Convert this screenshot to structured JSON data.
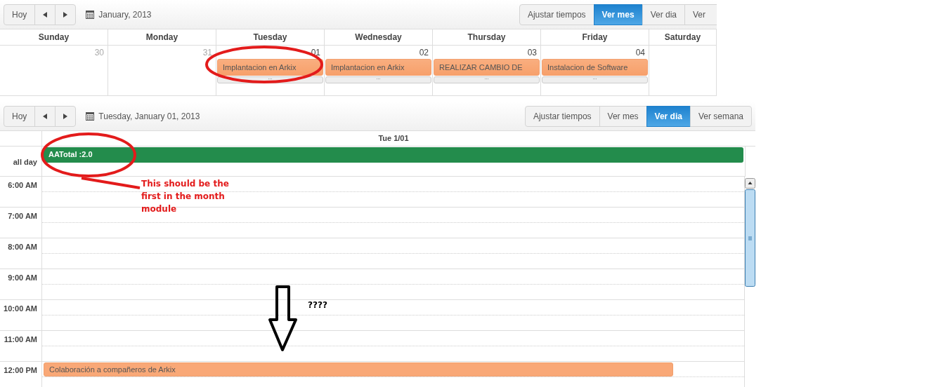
{
  "month_view": {
    "toolbar": {
      "today": "Hoy",
      "title": "January, 2013",
      "views": [
        {
          "label": "Ajustar tiempos",
          "selected": false
        },
        {
          "label": "Ver mes",
          "selected": true
        },
        {
          "label": "Ver dia",
          "selected": false
        },
        {
          "label": "Ver",
          "selected": false
        }
      ]
    },
    "weekdays": [
      "Sunday",
      "Monday",
      "Tuesday",
      "Wednesday",
      "Thursday",
      "Friday",
      "Saturday"
    ],
    "days": [
      {
        "number": "30",
        "other_month": true
      },
      {
        "number": "31",
        "other_month": true
      },
      {
        "number": "01",
        "other_month": false,
        "events": [
          {
            "title": "Implantacion en Arkix",
            "more": "..."
          }
        ]
      },
      {
        "number": "02",
        "other_month": false,
        "events": [
          {
            "title": "Implantacion en Arkix",
            "more": "..."
          }
        ]
      },
      {
        "number": "03",
        "other_month": false,
        "events": [
          {
            "title": "REALIZAR CAMBIO DE",
            "more": "..."
          }
        ]
      },
      {
        "number": "04",
        "other_month": false,
        "events": [
          {
            "title": "Instalacion de Software",
            "more": "..."
          }
        ]
      }
    ]
  },
  "day_view": {
    "toolbar": {
      "today": "Hoy",
      "title": "Tuesday, January 01, 2013",
      "views": [
        {
          "label": "Ajustar tiempos",
          "selected": false
        },
        {
          "label": "Ver mes",
          "selected": false
        },
        {
          "label": "Ver dia",
          "selected": true
        },
        {
          "label": "Ver semana",
          "selected": false
        }
      ]
    },
    "column_header": "Tue 1/01",
    "all_day_label": "all day",
    "all_day_events": [
      {
        "title": "AATotal :2.0",
        "color": "#238c4c"
      }
    ],
    "hours": [
      {
        "label": "6:00 AM"
      },
      {
        "label": "7:00 AM"
      },
      {
        "label": "8:00 AM"
      },
      {
        "label": "9:00 AM"
      },
      {
        "label": "10:00 AM"
      },
      {
        "label": "11:00 AM"
      },
      {
        "label": "12:00 PM",
        "events": [
          {
            "title": "Colaboración a compañeros de Arkix",
            "color": "#f9a877"
          }
        ]
      }
    ]
  },
  "annotations": [
    {
      "kind": "remark",
      "text": "This should be the first  in the month module",
      "color": "#e31b1b"
    },
    {
      "kind": "question",
      "text": "????",
      "color": "#000000"
    }
  ]
}
